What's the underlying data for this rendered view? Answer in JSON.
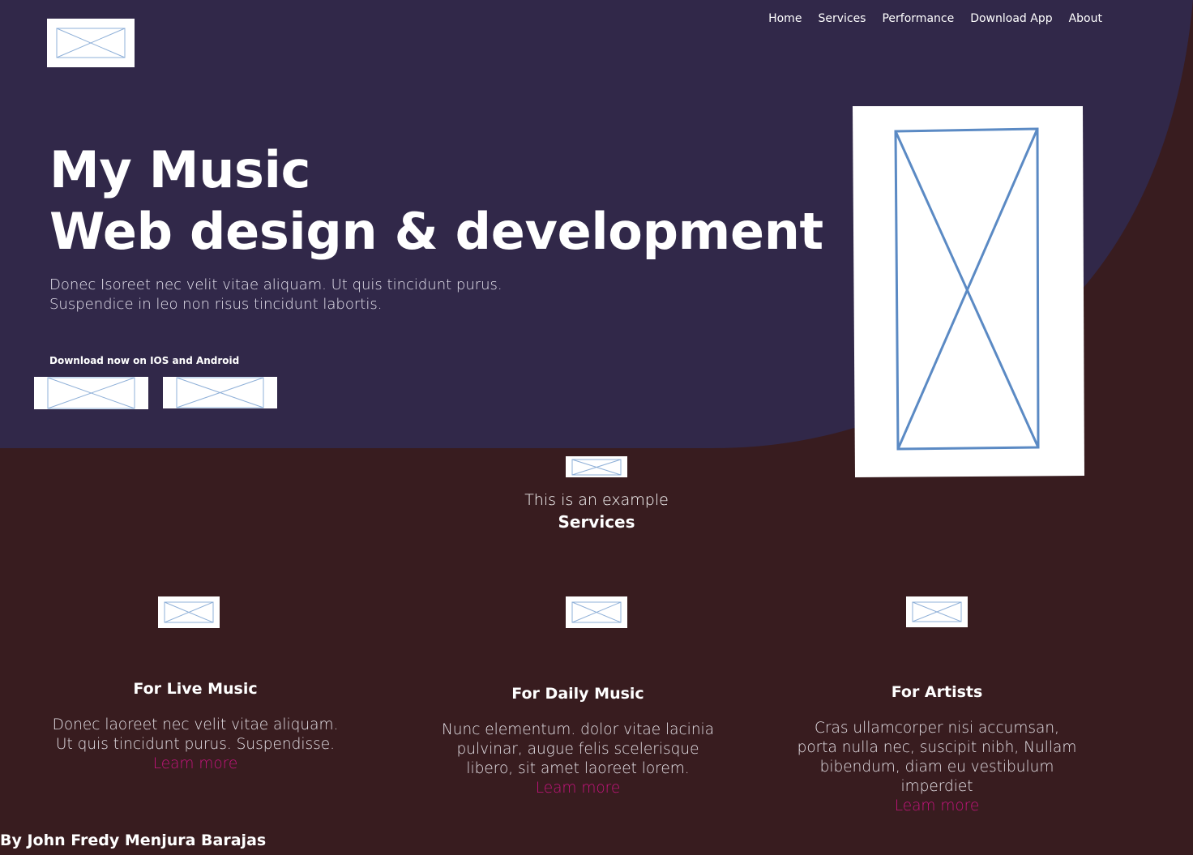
{
  "nav": {
    "items": [
      "Home",
      "Services",
      "Performance",
      "Download App",
      "About"
    ]
  },
  "hero": {
    "title_line1": "My Music",
    "title_line2": "Web design & development",
    "subtitle_line1": "Donec Isoreet nec velit vitae aliquam. Ut quis tincidunt purus.",
    "subtitle_line2": "Suspendice in leo non risus tincidunt labortis.",
    "download_label": "Download now on IOS and Android"
  },
  "services": {
    "eyebrow": "This is an example",
    "heading": "Services",
    "cards": [
      {
        "title": "For Live Music",
        "text_lines": [
          "Donec laoreet nec velit vitae aliquam.",
          "Ut quis tincidunt purus. Suspendisse."
        ],
        "link": "Leam more"
      },
      {
        "title": "For Daily Music",
        "text_lines": [
          "Nunc elementum. dolor vitae lacinia",
          "pulvinar, augue felis  scelerisque",
          "libero, sit amet laoreet lorem."
        ],
        "link": "Leam more"
      },
      {
        "title": "For Artists",
        "text_lines": [
          "Cras ullamcorper nisi accumsan,",
          "porta nulla nec, suscipit nibh, Nullam",
          "bibendum, diam eu vestibulum",
          "imperdiet"
        ],
        "link": "Leam more"
      }
    ]
  },
  "footer": {
    "credit": "By John Fredy Menjura Barajas"
  },
  "colors": {
    "hero_background": "#312849",
    "page_background": "#381c1f",
    "link": "#c6147e",
    "placeholder_stroke": "#5b8ac4"
  }
}
